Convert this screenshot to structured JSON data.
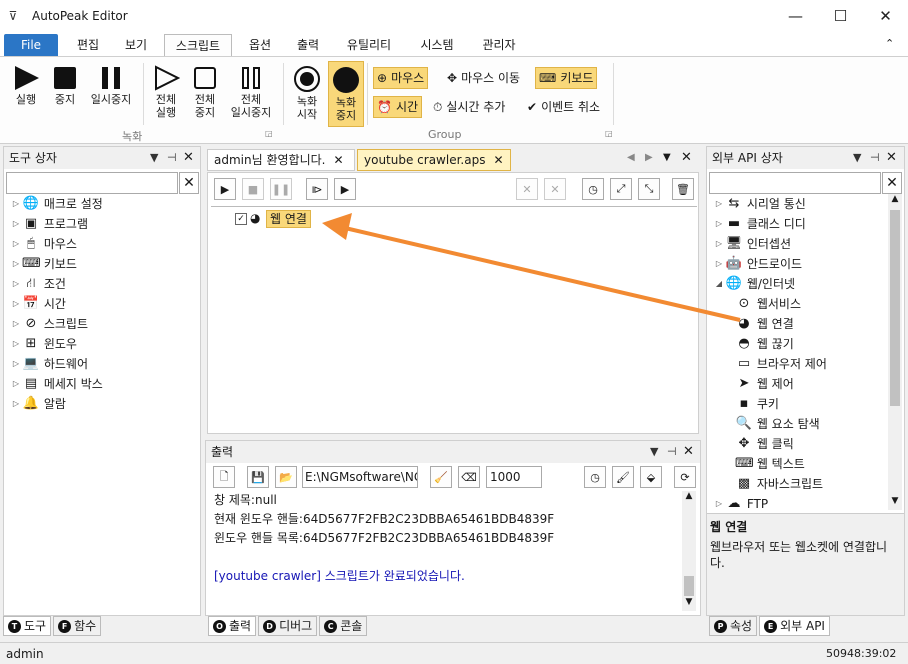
{
  "window": {
    "title": "AutoPeak Editor"
  },
  "menu": [
    "File",
    "편집",
    "보기",
    "스크립트",
    "옵션",
    "출력",
    "유틸리티",
    "시스템",
    "관리자"
  ],
  "ribbon": {
    "run": "실행",
    "stop": "중지",
    "pause": "일시중지",
    "all_run_1": "전체",
    "all_run_2": "실행",
    "all_stop_1": "전체",
    "all_stop_2": "중지",
    "all_pause_1": "전체",
    "all_pause_2": "일시중지",
    "rec_start_1": "녹화",
    "rec_start_2": "시작",
    "rec_stop_1": "녹화",
    "rec_stop_2": "중지",
    "mouse": "마우스",
    "mouse_move": "마우스 이동",
    "keyboard": "키보드",
    "time": "시간",
    "realtime_add": "실시간 추가",
    "event_cancel": "이벤트 취소",
    "group_record": "녹화",
    "group_group": "Group"
  },
  "toolbox": {
    "title": "도구 상자",
    "items": [
      "매크로 설정",
      "프로그램",
      "마우스",
      "키보드",
      "조건",
      "시간",
      "스크립트",
      "윈도우",
      "하드웨어",
      "메세지 박스",
      "알람"
    ],
    "tabs": [
      "도구",
      "함수"
    ]
  },
  "tabs": {
    "doc1": "admin님 환영합니다.",
    "doc2": "youtube crawler.aps"
  },
  "editor": {
    "node": "웹 연결"
  },
  "output": {
    "title": "출력",
    "path": "E:\\NGMsoftware\\NG",
    "count": "1000",
    "lines": [
      "창 제목:null",
      "현재 윈도우 핸들:64D5677F2FB2C23DBBA65461BDB4839F",
      "윈도우 핸들 목록:64D5677F2FB2C23DBBA65461BDB4839F",
      "",
      "[youtube crawler] 스크립트가 완료되었습니다."
    ],
    "tabs": [
      "출력",
      "디버그",
      "콘솔"
    ]
  },
  "api": {
    "title": "외부 API 상자",
    "items": [
      "시리얼 통신",
      "클래스 디디",
      "인터셉션",
      "안드로이드",
      "웹/인터넷",
      "웹서비스",
      "웹 연결",
      "웹 끊기",
      "브라우저 제어",
      "웹 제어",
      "쿠키",
      "웹 요소 탐색",
      "웹 클릭",
      "웹 텍스트",
      "자바스크립트",
      "FTP"
    ],
    "desc_title": "웹 연결",
    "desc": "웹브라우저 또는 웹소켓에 연결합니다.",
    "tabs": [
      "속성",
      "외부 API"
    ]
  },
  "status": {
    "user": "admin",
    "time": "50948:39:02"
  },
  "colors": {
    "accent": "#2b76c6",
    "highlight": "#f9d87a",
    "arrow": "#f28a32"
  }
}
